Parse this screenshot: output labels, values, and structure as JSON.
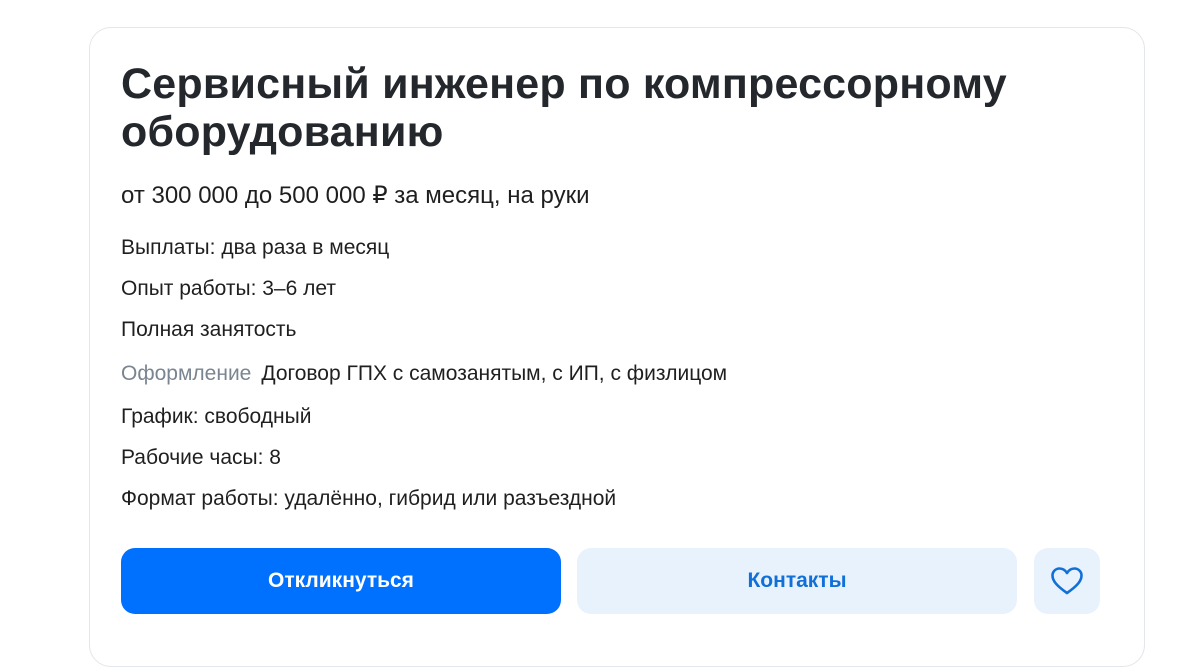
{
  "vacancy": {
    "title": "Сервисный инженер по компрессорному оборудованию",
    "salary": "от 300 000 до 500 000 ₽ за месяц, на руки",
    "payouts": "Выплаты: два раза в месяц",
    "experience": "Опыт работы: 3–6 лет",
    "employment": "Полная занятость",
    "contract_label": "Оформление",
    "contract_value": "Договор ГПХ с самозанятым, с ИП, с физлицом",
    "schedule": "График: свободный",
    "hours": "Рабочие часы: 8",
    "work_format": "Формат работы: удалённо, гибрид или разъездной"
  },
  "actions": {
    "respond_label": "Откликнуться",
    "contacts_label": "Контакты",
    "favorite_icon": "heart-icon"
  },
  "colors": {
    "primary": "#0070ff",
    "secondary_bg": "#e8f2fd",
    "secondary_text": "#1170d8",
    "muted_text": "#7a8591"
  }
}
